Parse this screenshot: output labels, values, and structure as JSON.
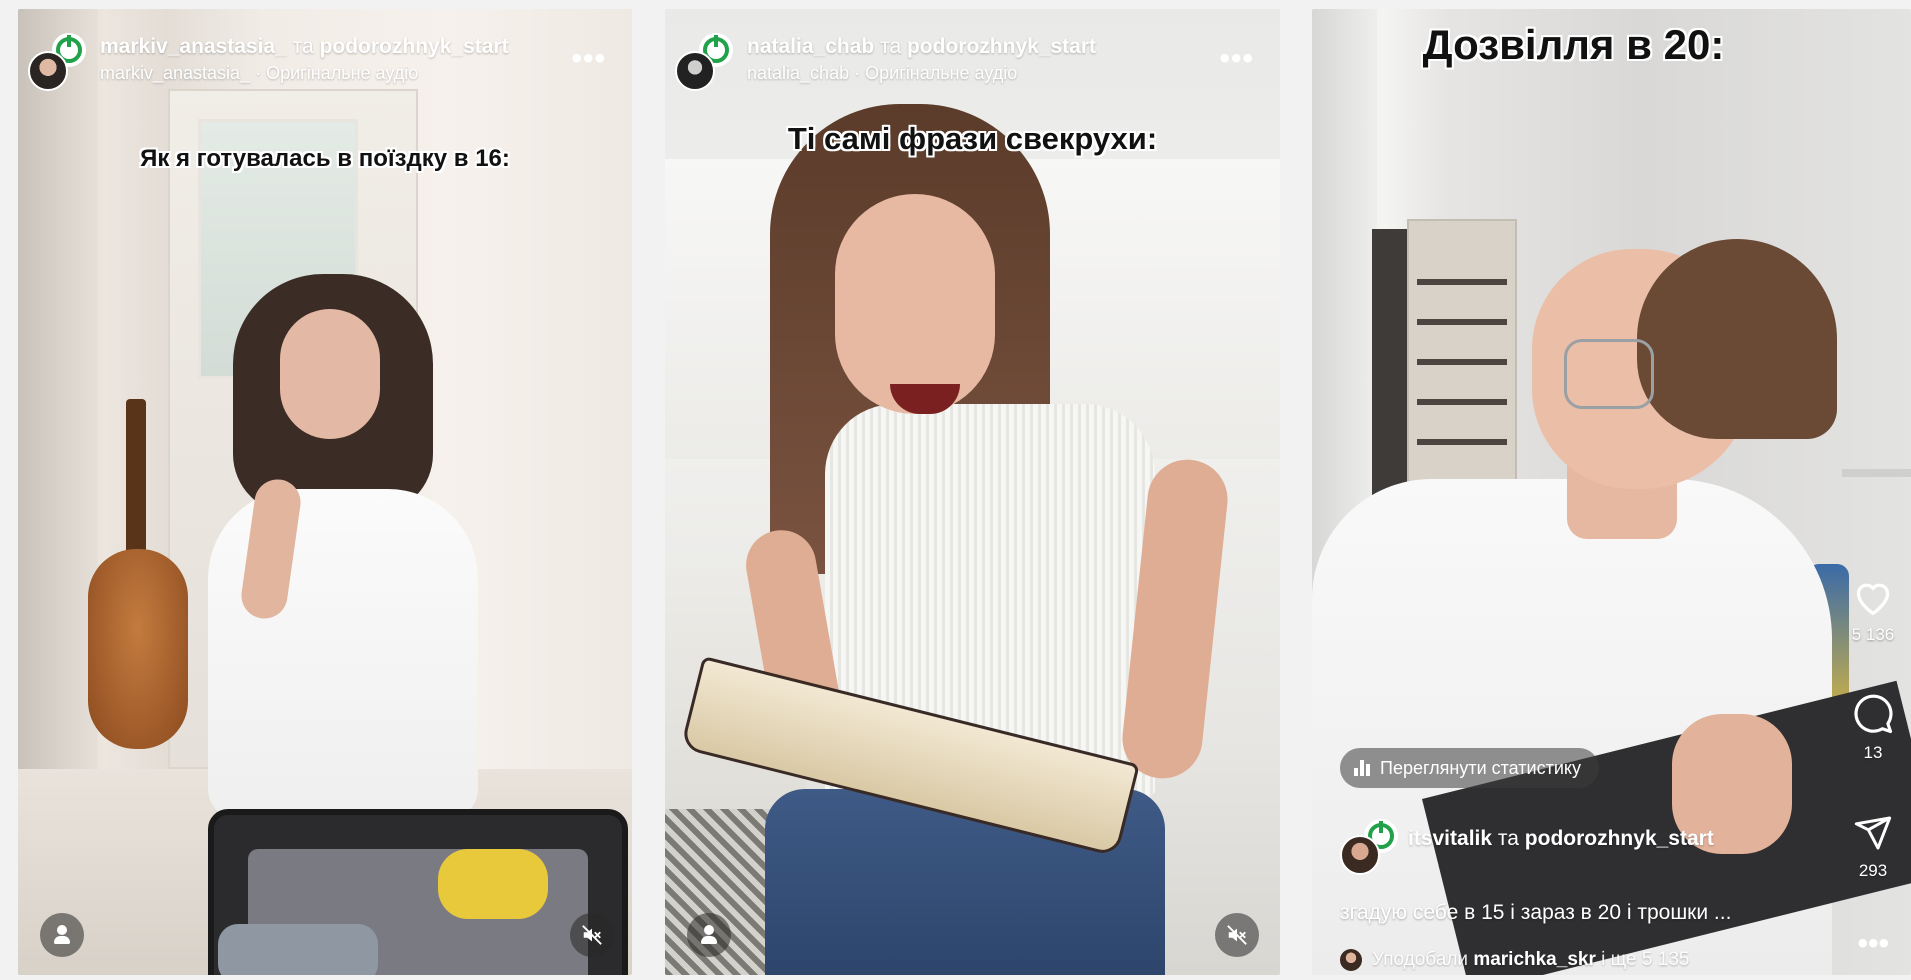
{
  "reels": [
    {
      "owner": "markiv_anastasia_",
      "conjunction": "та",
      "collaborator": "podorozhnyk_start",
      "audio_owner": "markiv_anastasia_",
      "audio_sep": "·",
      "audio_label": "Оригінальне аудіо",
      "more_label": "•••",
      "caption": "Як я готувалась в поїздку в 16:",
      "icons": {
        "profile": "user-icon",
        "mute": "muted-speaker-icon"
      }
    },
    {
      "owner": "natalia_chab",
      "conjunction": "та",
      "collaborator": "podorozhnyk_start",
      "audio_owner": "natalia_chab",
      "audio_sep": "·",
      "audio_label": "Оригінальне аудіо",
      "more_label": "•••",
      "caption": "Ті самі фрази свекрухи:",
      "icons": {
        "profile": "user-icon",
        "mute": "muted-speaker-icon"
      }
    },
    {
      "caption": "Дозвілля в 20:",
      "stats_label": "Переглянути статистику",
      "owner": "itsvitalik",
      "conjunction": "та",
      "collaborator": "podorozhnyk_start",
      "description": "згадую себе в 15 і зараз в 20 і трошки ...",
      "liked_prefix": "Уподобали",
      "liked_user": "marichka_skr",
      "liked_suffix": "і ще 5 135",
      "likes": "5 136",
      "comments": "13",
      "shares": "293",
      "more_label": "•••",
      "icons": {
        "like": "heart-icon",
        "comment": "comment-bubble-icon",
        "share": "send-icon",
        "stats": "bar-chart-icon"
      }
    }
  ],
  "colors": {
    "brand_ring": "#21a24a",
    "overlay_text": "#ffffff",
    "caption_text": "#111111"
  }
}
